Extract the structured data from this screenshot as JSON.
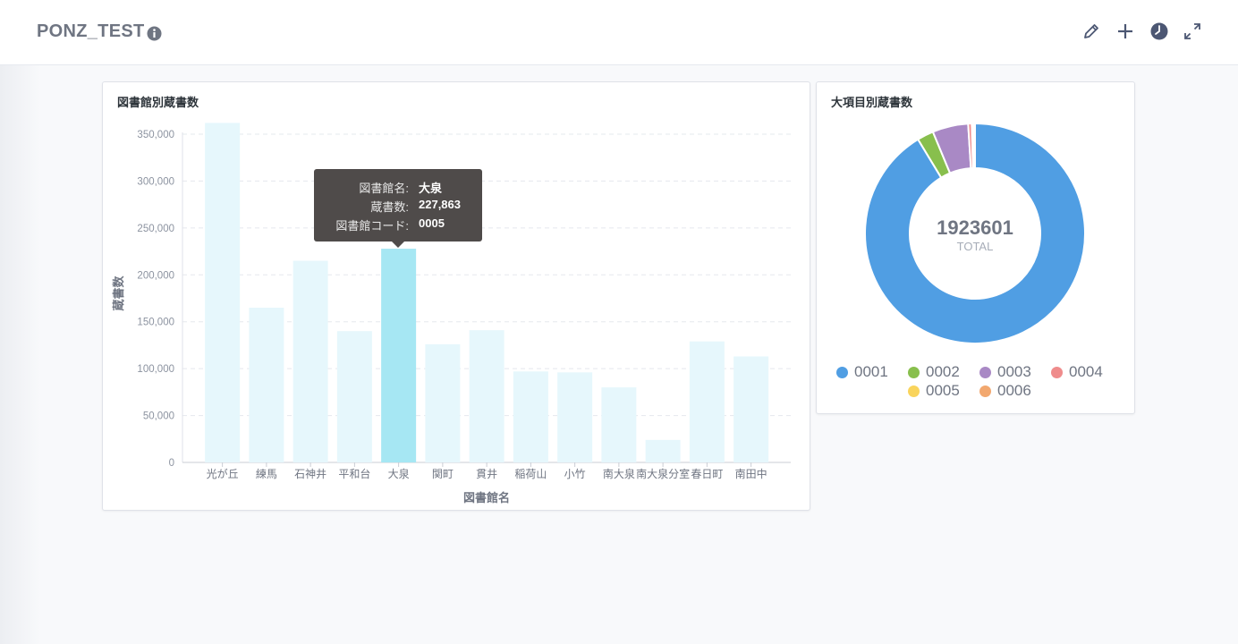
{
  "header": {
    "title": "PONZ_TEST",
    "info_icon": "info-icon",
    "actions": [
      {
        "name": "edit-button",
        "icon": "pencil-icon"
      },
      {
        "name": "add-button",
        "icon": "plus-icon"
      },
      {
        "name": "history-button",
        "icon": "clock-icon"
      },
      {
        "name": "fullscreen-button",
        "icon": "expand-icon"
      }
    ]
  },
  "bar_card": {
    "title": "図書館別蔵書数",
    "tooltip": {
      "rows": [
        {
          "key": "図書館名:",
          "value": "大泉"
        },
        {
          "key": "蔵書数:",
          "value": "227,863"
        },
        {
          "key": "図書館コード:",
          "value": "0005"
        }
      ]
    }
  },
  "donut_card": {
    "title": "大項目別蔵書数",
    "total_value": "1923601",
    "total_label": "TOTAL"
  },
  "colors": {
    "bar_normal": "#e6f7fc",
    "bar_highlight": "#a6e7f3",
    "series": [
      "#509ee3",
      "#88bf4d",
      "#a989c5",
      "#ef8c8c",
      "#f9d45c",
      "#f2a86f"
    ]
  },
  "chart_data": [
    {
      "type": "bar",
      "title": "図書館別蔵書数",
      "xlabel": "図書館名",
      "ylabel": "蔵書数",
      "categories": [
        "光が丘",
        "練馬",
        "石神井",
        "平和台",
        "大泉",
        "関町",
        "貫井",
        "稲荷山",
        "小竹",
        "南大泉",
        "南大泉分室",
        "春日町",
        "南田中"
      ],
      "values": [
        362000,
        165000,
        215000,
        140000,
        227863,
        126000,
        141000,
        97000,
        96000,
        80000,
        24000,
        129000,
        113000
      ],
      "ylim": [
        0,
        350000
      ],
      "yticks": [
        0,
        50000,
        100000,
        150000,
        200000,
        250000,
        300000,
        350000
      ],
      "ytick_labels": [
        "0",
        "50,000",
        "100,000",
        "150,000",
        "200,000",
        "250,000",
        "300,000",
        "350,000"
      ],
      "highlight_index": 4,
      "grid": true
    },
    {
      "type": "pie",
      "title": "大項目別蔵書数",
      "donut": true,
      "total": 1923601,
      "categories": [
        "0001",
        "0002",
        "0003",
        "0004",
        "0005",
        "0006"
      ],
      "values": [
        1738000,
        46000,
        100000,
        10000,
        4000,
        5000
      ],
      "legend": "bottom"
    }
  ]
}
